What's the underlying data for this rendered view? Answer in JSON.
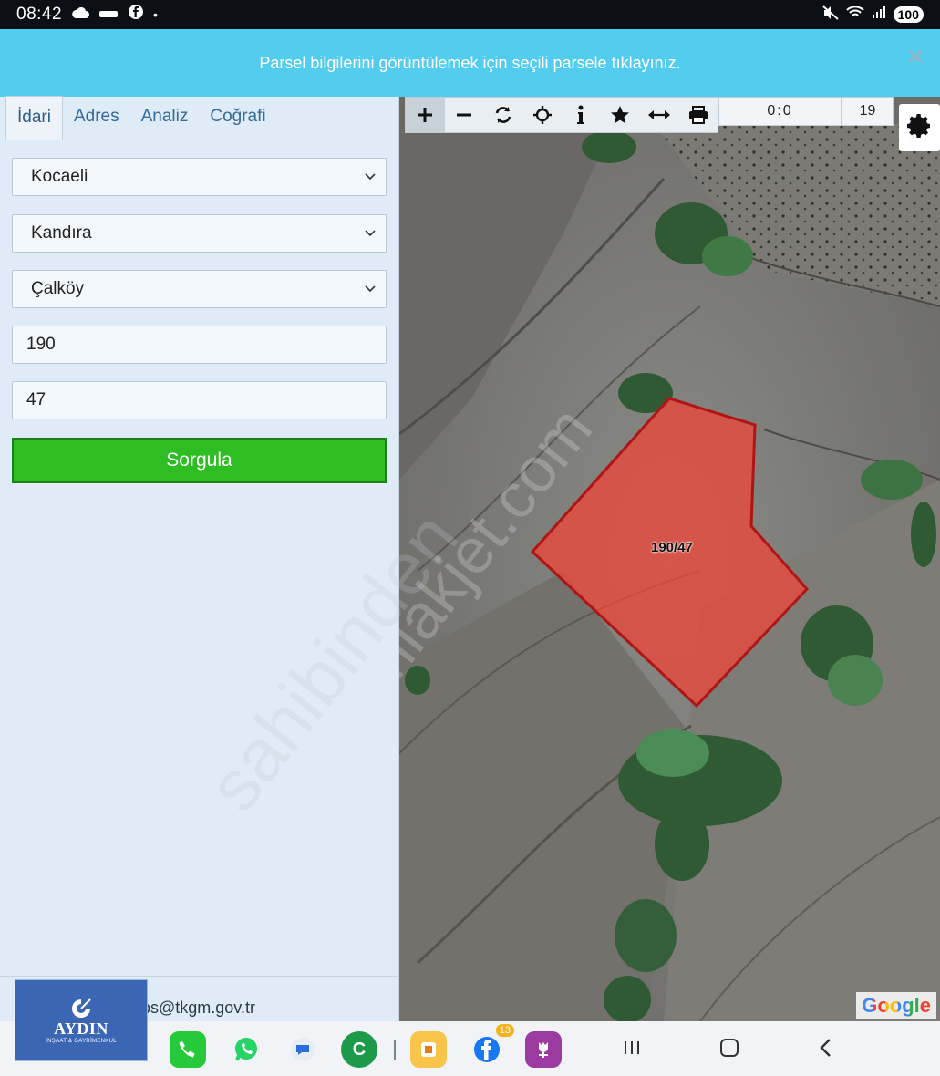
{
  "status_bar": {
    "time": "08:42",
    "battery": "100"
  },
  "banner": {
    "message": "Parsel bilgilerini görüntülemek için seçili parsele tıklayınız.",
    "close_label": "×"
  },
  "sidebar": {
    "tabs": [
      {
        "label": "İdari",
        "active": true
      },
      {
        "label": "Adres",
        "active": false
      },
      {
        "label": "Analiz",
        "active": false
      },
      {
        "label": "Coğrafi",
        "active": false
      }
    ],
    "province": "Kocaeli",
    "district": "Kandıra",
    "neighborhood": "Çalköy",
    "block_no": "190",
    "parcel_no": "47",
    "query_button": "Sorgula",
    "footer_email": "cbs@tkgm.gov.tr"
  },
  "map": {
    "toolbar_icons": [
      "zoom-in-icon",
      "zoom-out-icon",
      "refresh-icon",
      "locate-icon",
      "info-icon",
      "favorite-star-icon",
      "measure-icon",
      "print-icon"
    ],
    "scale_readout": "0:0",
    "zoom_level": "19",
    "parcel_label": "190/47",
    "attribution": "Google",
    "parcel_fill_color": "#e8483c",
    "parcel_stroke_color": "#b01515"
  },
  "watermark": {
    "lines": [
      "emlakjet.com",
      "sahibinden"
    ]
  },
  "logo": {
    "brand": "AYDIN",
    "subtitle": "İNŞAAT & GAYRİMENKUL"
  },
  "dock": {
    "facebook_badge": "13"
  }
}
